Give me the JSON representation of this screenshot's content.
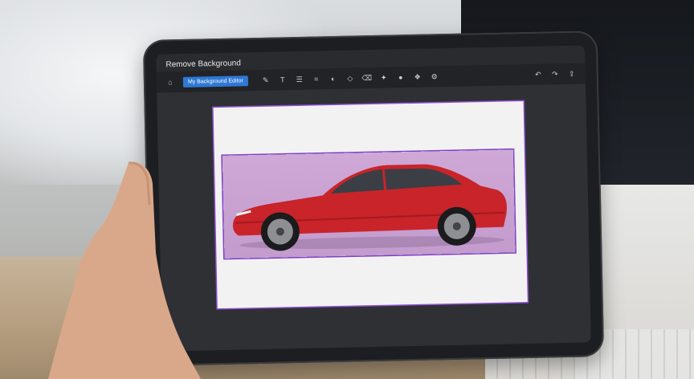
{
  "app": {
    "title": "Remove Background",
    "primary_button_label": "My Background Editor"
  },
  "toolbar": {
    "icons": [
      "home-icon",
      "brush-icon",
      "text-icon",
      "layers-icon",
      "crop-icon",
      "adjust-icon",
      "shape-icon",
      "eraser-icon",
      "wand-icon",
      "color-icon",
      "effects-icon",
      "settings-icon"
    ],
    "right_icons": [
      "undo-icon",
      "redo-icon",
      "share-icon"
    ]
  },
  "colors": {
    "accent": "#2f78d6",
    "selection": "#7a41c7",
    "car": "#c8242a",
    "backdrop": "#c9a3d2"
  }
}
